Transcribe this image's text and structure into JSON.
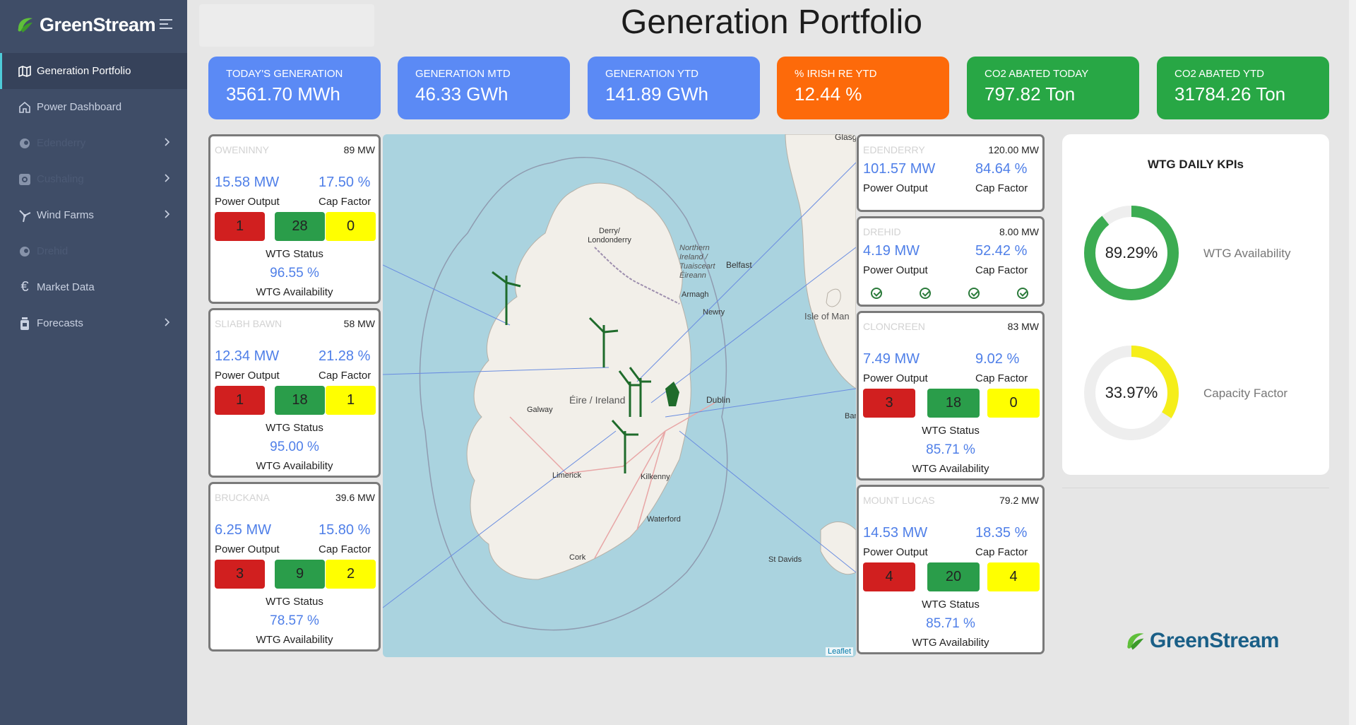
{
  "brand": {
    "name": "GreenStream"
  },
  "sidebar": {
    "items": [
      {
        "label": "Generation Portfolio",
        "icon": "map-icon",
        "active": true
      },
      {
        "label": "Power Dashboard",
        "icon": "home-icon"
      },
      {
        "label": "Edenderry",
        "icon": "plant-icon",
        "faded": true,
        "chevron": true
      },
      {
        "label": "Cushaling",
        "icon": "target-icon",
        "faded": true,
        "chevron": true
      },
      {
        "label": "Wind Farms",
        "icon": "wind-icon",
        "chevron": true
      },
      {
        "label": "Drehid",
        "icon": "plant-icon",
        "faded": true
      },
      {
        "label": "Market Data",
        "icon": "euro-icon"
      },
      {
        "label": "Forecasts",
        "icon": "jar-icon",
        "chevron": true
      }
    ]
  },
  "page": {
    "title": "Generation Portfolio"
  },
  "kpis": [
    {
      "label": "TODAY'S GENERATION",
      "value": "3561.70 MWh",
      "color": "#5b8af5"
    },
    {
      "label": "GENERATION MTD",
      "value": "46.33 GWh",
      "color": "#5b8af5"
    },
    {
      "label": "GENERATION YTD",
      "value": "141.89 GWh",
      "color": "#5b8af5"
    },
    {
      "label": "% IRISH RE YTD",
      "value": "12.44 %",
      "color": "#fd6a0a"
    },
    {
      "label": "CO2 ABATED TODAY",
      "value": "797.82 Ton",
      "color": "#28a745"
    },
    {
      "label": "CO2 ABATED YTD",
      "value": "31784.26 Ton",
      "color": "#28a745"
    }
  ],
  "labels": {
    "power_output": "Power Output",
    "cap_factor": "Cap Factor",
    "wtg_status": "WTG Status",
    "wtg_availability": "WTG Availability"
  },
  "farms_left": [
    {
      "name": "OWENINNY",
      "capacity": "89 MW",
      "power": "15.58 MW",
      "cap_factor": "17.50 %",
      "status": [
        "1",
        "28",
        "0"
      ],
      "availability": "96.55 %"
    },
    {
      "name": "SLIABH BAWN",
      "capacity": "58 MW",
      "power": "12.34 MW",
      "cap_factor": "21.28 %",
      "status": [
        "1",
        "18",
        "1"
      ],
      "availability": "95.00 %"
    },
    {
      "name": "BRUCKANA",
      "capacity": "39.6 MW",
      "power": "6.25 MW",
      "cap_factor": "15.80 %",
      "status": [
        "3",
        "9",
        "2"
      ],
      "availability": "78.57 %"
    }
  ],
  "plants_right": [
    {
      "name": "EDENDERRY",
      "capacity": "120.00 MW",
      "power": "101.57 MW",
      "cap_factor": "84.64 %"
    },
    {
      "name": "DREHID",
      "capacity": "8.00 MW",
      "power": "4.19 MW",
      "cap_factor": "52.42 %"
    }
  ],
  "farms_right": [
    {
      "name": "CLONCREEN",
      "capacity": "83 MW",
      "power": "7.49 MW",
      "cap_factor": "9.02 %",
      "status": [
        "3",
        "18",
        "0"
      ],
      "availability": "85.71 %"
    },
    {
      "name": "MOUNT LUCAS",
      "capacity": "79.2 MW",
      "power": "14.53 MW",
      "cap_factor": "18.35 %",
      "status": [
        "4",
        "20",
        "4"
      ],
      "availability": "85.71 %"
    }
  ],
  "map": {
    "places": [
      "Glasg",
      "Derry/ Londonderry",
      "Northern Ireland / Tuaisceart Éireann",
      "Belfast",
      "Armagh",
      "Newry",
      "Isle of Man",
      "Éire / Ireland",
      "Galway",
      "Dublin",
      "Limerick",
      "Kilkenny",
      "Waterford",
      "Cork",
      "St Davids",
      "Bar"
    ],
    "attribution": "Leaflet"
  },
  "wtg_kpis": {
    "title": "WTG DAILY KPIs",
    "availability": {
      "value": "89.29%",
      "label": "WTG Availability",
      "fraction": 0.8929,
      "color": "#3cac52"
    },
    "capacity_factor": {
      "value": "33.97%",
      "label": "Capacity Factor",
      "fraction": 0.3397,
      "color": "#f5ee1a"
    }
  }
}
